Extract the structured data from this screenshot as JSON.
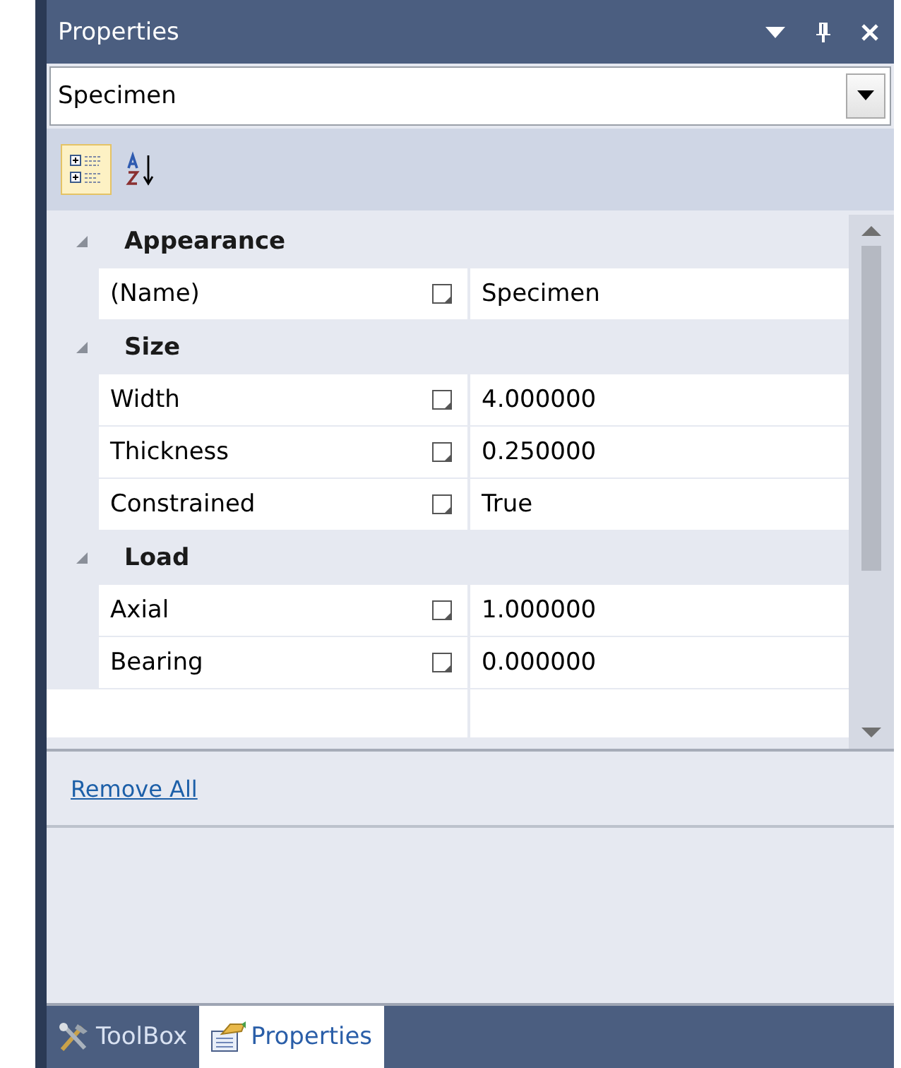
{
  "window": {
    "title": "Properties"
  },
  "object_selector": {
    "value": "Specimen"
  },
  "toolbar": [
    {
      "kind": "categorized",
      "selected": true
    },
    {
      "kind": "alphabetical",
      "selected": false
    }
  ],
  "categories": [
    {
      "name": "Appearance",
      "expanded": true,
      "properties": [
        {
          "name": "(Name)",
          "value": "Specimen"
        }
      ]
    },
    {
      "name": "Size",
      "expanded": true,
      "properties": [
        {
          "name": "Width",
          "value": "4.000000"
        },
        {
          "name": "Thickness",
          "value": "0.250000"
        },
        {
          "name": "Constrained",
          "value": "True"
        }
      ]
    },
    {
      "name": "Load",
      "expanded": true,
      "properties": [
        {
          "name": "Axial",
          "value": "1.000000"
        },
        {
          "name": "Bearing",
          "value": "0.000000"
        }
      ]
    }
  ],
  "commands": [
    {
      "label": "Remove All"
    }
  ],
  "tabs": [
    {
      "label": "ToolBox",
      "kind": "toolbox",
      "selected": false
    },
    {
      "label": "Properties",
      "kind": "properties",
      "selected": true
    }
  ]
}
